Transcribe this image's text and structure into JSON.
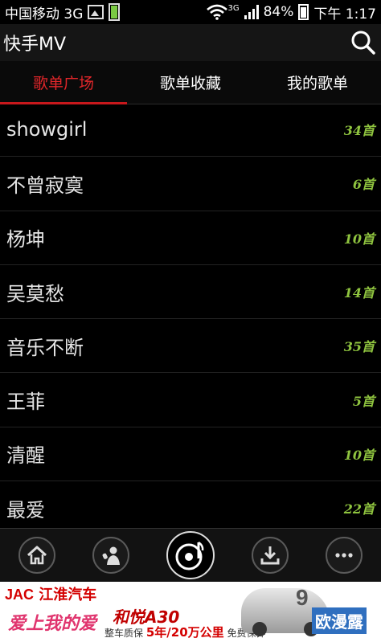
{
  "status_bar": {
    "carrier": "中国移动 3G",
    "network": "3G",
    "battery": "84%",
    "time": "下午 1:17"
  },
  "header": {
    "title": "快手MV"
  },
  "tabs": [
    {
      "label": "歌单广场",
      "active": true
    },
    {
      "label": "歌单收藏",
      "active": false
    },
    {
      "label": "我的歌单",
      "active": false
    }
  ],
  "playlists": [
    {
      "name": "showgirl",
      "count": "34首"
    },
    {
      "name": "不曾寂寞",
      "count": "6首"
    },
    {
      "name": "杨坤",
      "count": "10首"
    },
    {
      "name": "吴莫愁",
      "count": "14首"
    },
    {
      "name": "音乐不断",
      "count": "35首"
    },
    {
      "name": "王菲",
      "count": "5首"
    },
    {
      "name": "清醒",
      "count": "10首"
    },
    {
      "name": "最爱",
      "count": "22首"
    }
  ],
  "bottom_nav": [
    "home-icon",
    "singer-icon",
    "music-disc-icon",
    "download-icon",
    "more-icon"
  ],
  "ad": {
    "brand": "JAC",
    "brand_text": "江淮汽车",
    "slogan": "爱上我的爱",
    "model": "和悦A30",
    "warranty_prefix": "整车质保",
    "warranty": "5年/20万公里",
    "warranty_suffix": "免费保养"
  },
  "watermark": {
    "number": "9",
    "text": "欧漫露"
  },
  "colors": {
    "accent_red": "#e1262a",
    "count_green": "#8fc43f",
    "background": "#000000"
  }
}
